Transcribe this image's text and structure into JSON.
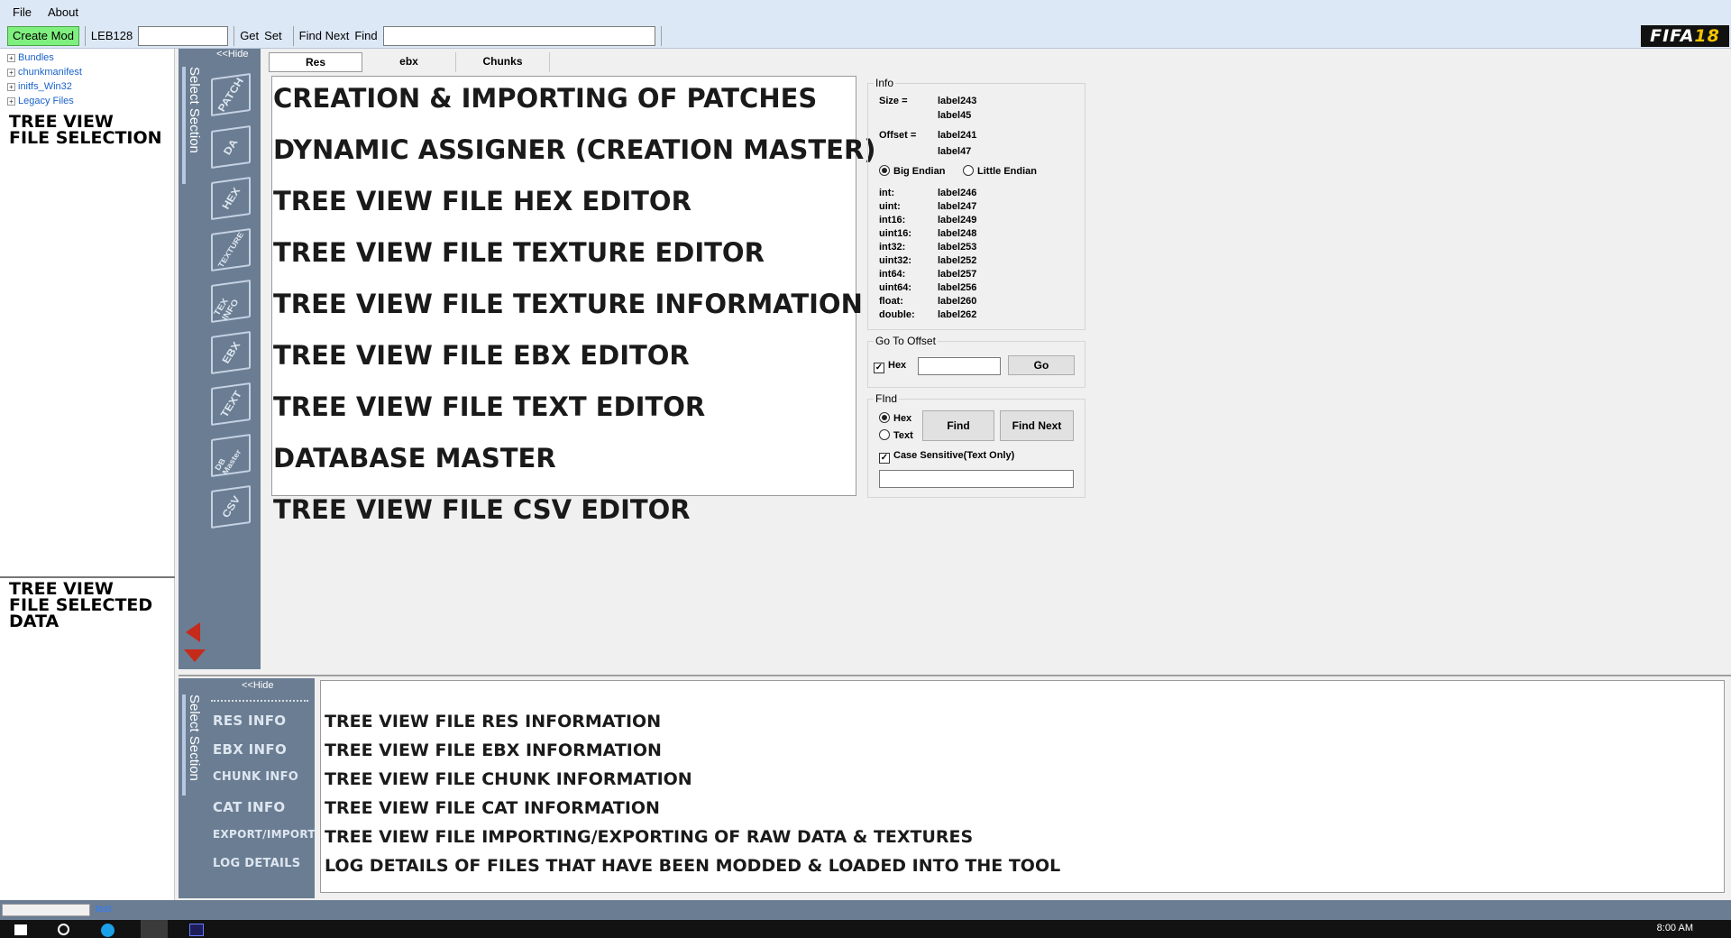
{
  "menu": {
    "file": "File",
    "about": "About"
  },
  "toolbar": {
    "create_mod": "Create Mod",
    "leb128_label": "LEB128",
    "get": "Get",
    "set": "Set",
    "find_next": "Find Next",
    "find": "Find"
  },
  "logo": {
    "left": "FIFA",
    "right": "18"
  },
  "tree": {
    "items": [
      "Bundles",
      "chunkmanifest",
      "initfs_Win32",
      "Legacy Files"
    ],
    "label_line1": "TREE VIEW",
    "label_line2": "FILE SELECTION"
  },
  "selected_data": {
    "line1": "TREE VIEW",
    "line2": "FILE SELECTED",
    "line3": "DATA"
  },
  "top_strip": {
    "hide": "<<Hide",
    "title": "Select Section",
    "icons": [
      "PATCH",
      "DA",
      "HEX",
      "TEXTURE",
      "TEX INFO",
      "EBX",
      "TEXT",
      "DB Master",
      "CSV"
    ]
  },
  "tabs": [
    "Res",
    "ebx",
    "Chunks"
  ],
  "sections": [
    "CREATION & IMPORTING OF PATCHES",
    "DYNAMIC ASSIGNER (CREATION MASTER)",
    "TREE VIEW FILE HEX EDITOR",
    "TREE VIEW FILE TEXTURE EDITOR",
    "TREE VIEW FILE TEXTURE INFORMATION",
    "TREE VIEW FILE EBX EDITOR",
    "TREE VIEW FILE TEXT EDITOR",
    "DATABASE MASTER",
    "TREE VIEW FILE CSV EDITOR"
  ],
  "info": {
    "title": "Info",
    "size_label": "Size =",
    "size_val1": "label243",
    "size_val2": "label45",
    "offset_label": "Offset =",
    "offset_val1": "label241",
    "offset_val2": "label47",
    "big_endian": "Big Endian",
    "little_endian": "Little Endian",
    "types": [
      {
        "name": "int:",
        "value": "label246"
      },
      {
        "name": "uint:",
        "value": "label247"
      },
      {
        "name": "int16:",
        "value": "label249"
      },
      {
        "name": "uint16:",
        "value": "label248"
      },
      {
        "name": "int32:",
        "value": "label253"
      },
      {
        "name": "uint32:",
        "value": "label252"
      },
      {
        "name": "int64:",
        "value": "label257"
      },
      {
        "name": "uint64:",
        "value": "label256"
      },
      {
        "name": "float:",
        "value": "label260"
      },
      {
        "name": "double:",
        "value": "label262"
      }
    ]
  },
  "goto": {
    "title": "Go To Offset",
    "hex": "Hex",
    "go": "Go"
  },
  "find_group": {
    "title": "FInd",
    "hex": "Hex",
    "text": "Text",
    "find": "Find",
    "find_next": "Find Next",
    "case_sensitive": "Case Sensitive(Text Only)"
  },
  "bottom_strip": {
    "hide": "<<Hide",
    "title": "Select Section",
    "items": [
      "RES INFO",
      "EBX INFO",
      "CHUNK INFO",
      "CAT INFO",
      "EXPORT/IMPORT",
      "LOG DETAILS"
    ]
  },
  "bottom_sections": [
    "TREE VIEW FILE RES INFORMATION",
    "TREE VIEW FILE EBX INFORMATION",
    "TREE VIEW FILE CHUNK INFORMATION",
    "TREE VIEW FILE CAT INFORMATION",
    "TREE VIEW FILE IMPORTING/EXPORTING OF RAW DATA & TEXTURES",
    "LOG DETAILS OF FILES THAT HAVE BEEN MODDED & LOADED INTO THE TOOL"
  ],
  "status": {
    "text": "test"
  },
  "taskbar": {
    "clock": "8:00 AM"
  },
  "colors": {
    "accent_green": "#7ff07f",
    "strip": "#6b7d92",
    "arrow_red": "#c62a1a",
    "link_blue": "#1a62c9"
  }
}
